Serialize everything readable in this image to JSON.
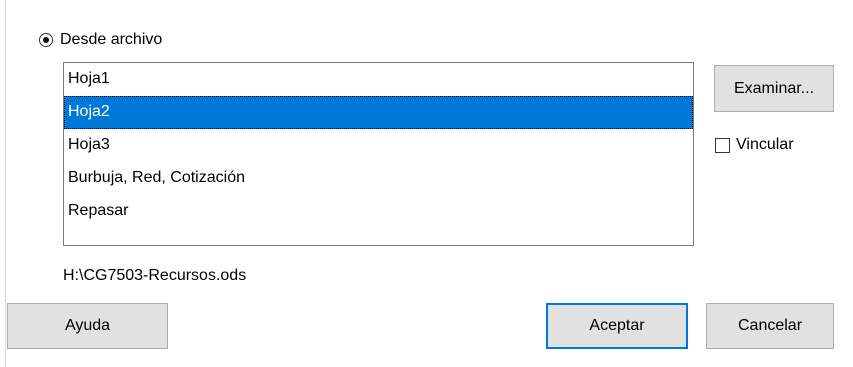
{
  "source": {
    "radio_label": "Desde archivo",
    "selected": true
  },
  "sheets": [
    {
      "label": "Hoja1",
      "selected": false
    },
    {
      "label": "Hoja2",
      "selected": true
    },
    {
      "label": "Hoja3",
      "selected": false
    },
    {
      "label": "Burbuja, Red, Cotización",
      "selected": false
    },
    {
      "label": "Repasar",
      "selected": false
    }
  ],
  "file_path": "H:\\CG7503-Recursos.ods",
  "buttons": {
    "browse": "Examinar...",
    "help": "Ayuda",
    "ok": "Aceptar",
    "cancel": "Cancelar"
  },
  "link": {
    "label": "Vincular",
    "checked": false
  },
  "colors": {
    "selection": "#0078d7",
    "button_face": "#e1e1e1",
    "default_button_border": "#0078d7"
  }
}
